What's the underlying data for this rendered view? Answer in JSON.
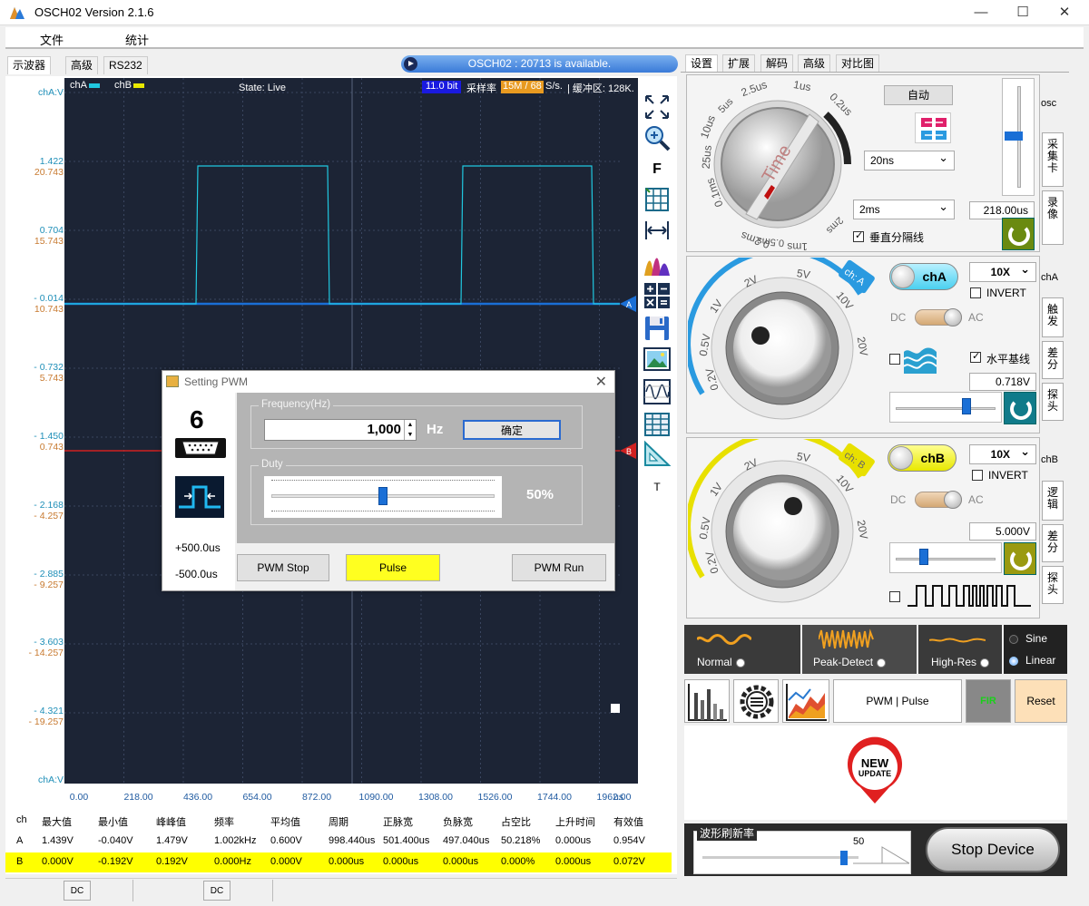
{
  "window": {
    "title": "OSCH02  Version 2.1.6",
    "minimize": "—",
    "maximize": "☐",
    "close": "✕"
  },
  "menu": {
    "file": "文件",
    "stats": "统计"
  },
  "left_tabs": [
    "示波器",
    "高级",
    "RS232"
  ],
  "banner": {
    "text": "OSCH02 : 20713 is available."
  },
  "scope": {
    "cha_label": "chA",
    "chb_label": "chB",
    "state": "State: Live",
    "bits": "11.0 bit",
    "sample_rate_label": "采样率",
    "sample_rate_value": "15M / 68",
    "sample_rate_unit": "S/s.",
    "buffer": "| 缓冲区: 128K.",
    "axis_top_label": "chA:V",
    "axis_bottom_label": "chA:V",
    "marker_a": "A",
    "marker_b": "B",
    "x_unit": "us",
    "y_labels": [
      {
        "a": "1.422",
        "b": "20.743"
      },
      {
        "a": "0.704",
        "b": "15.743"
      },
      {
        "a": "- 0.014",
        "b": "10.743"
      },
      {
        "a": "- 0.732",
        "b": "5.743"
      },
      {
        "a": "- 1.450",
        "b": "0.743"
      },
      {
        "a": "- 2.168",
        "b": "- 4.257"
      },
      {
        "a": "- 2.885",
        "b": "- 9.257"
      },
      {
        "a": "- 3.603",
        "b": "- 14.257"
      },
      {
        "a": "- 4.321",
        "b": "- 19.257"
      }
    ],
    "x_labels": [
      "0.00",
      "218.00",
      "436.00",
      "654.00",
      "872.00",
      "1090.00",
      "1308.00",
      "1526.00",
      "1744.00",
      "1962.00"
    ]
  },
  "tools": {
    "f_label": "F",
    "t_label": "T"
  },
  "measurements": {
    "headers": [
      "ch",
      "最大值",
      "最小值",
      "峰峰值",
      "频率",
      "平均值",
      "周期",
      "正脉宽",
      "负脉宽",
      "占空比",
      "上升时间",
      "有效值"
    ],
    "rows": [
      [
        "A",
        "1.439V",
        "-0.040V",
        "1.479V",
        "1.002kHz",
        "0.600V",
        "998.440us",
        "501.400us",
        "497.040us",
        "50.218%",
        "0.000us",
        "0.954V"
      ],
      [
        "B",
        "0.000V",
        "-0.192V",
        "0.192V",
        "0.000Hz",
        "0.000V",
        "0.000us",
        "0.000us",
        "0.000us",
        "0.000%",
        "0.000us",
        "0.072V"
      ]
    ]
  },
  "status": {
    "dc1": "DC",
    "dc2": "DC"
  },
  "pwm_dialog": {
    "title": "Setting PWM",
    "pin": "6",
    "plus": "+500.0us",
    "minus": "-500.0us",
    "freq_group": "Frequency(Hz)",
    "freq_value": "1,000",
    "freq_unit": "Hz",
    "confirm": "确定",
    "duty_group": "Duty",
    "duty_value": "50%",
    "duty_fraction": 0.5,
    "btn_stop": "PWM Stop",
    "btn_pulse": "Pulse",
    "btn_run": "PWM Run"
  },
  "right_tabs": [
    "设置",
    "扩展",
    "解码",
    "高级",
    "对比图"
  ],
  "time_panel": {
    "dial_labels": [
      "2.5us",
      "1us",
      "0.2us",
      "5us",
      "10us",
      "25us",
      "0.1ms",
      "0.2ms",
      "0.5ms",
      "1ms",
      "2ms"
    ],
    "dial_name": "Time",
    "auto": "自动",
    "select1": "20ns",
    "select2": "2ms",
    "vgrid_label": "垂直分隔线",
    "time_value": "218.00us",
    "side_osc": "osc",
    "tab_capture": "采集卡",
    "tab_record": "录像"
  },
  "cha_panel": {
    "dial_labels": [
      "2V",
      "5V",
      "1V",
      "10V",
      "0.5V",
      "20V",
      "0.2V"
    ],
    "tag": "ch: A",
    "pill": "chA",
    "probe": "10X",
    "invert": "INVERT",
    "dc": "DC",
    "ac": "AC",
    "baseline": "水平基线",
    "value": "0.718V",
    "slider_fraction": 0.72,
    "side": "chA",
    "tab_trigger": "触发",
    "tab_diff": "差分",
    "tab_probe": "探头"
  },
  "chb_panel": {
    "dial_labels": [
      "2V",
      "5V",
      "1V",
      "10V",
      "0.5V",
      "20V",
      "0.2V"
    ],
    "tag": "ch: B",
    "pill": "chB",
    "probe": "10X",
    "invert": "INVERT",
    "dc": "DC",
    "ac": "AC",
    "value": "5.000V",
    "slider_fraction": 0.25,
    "side": "chB",
    "tab_logic": "逻辑",
    "tab_diff": "差分",
    "tab_probe": "探头"
  },
  "modes": {
    "normal": "Normal",
    "peak": "Peak-Detect",
    "highres": "High-Res",
    "sine": "Sine",
    "linear": "Linear"
  },
  "actions": {
    "pwm_pulse": "PWM | Pulse",
    "fir": "FIR",
    "reset": "Reset"
  },
  "update_badge": {
    "line1": "NEW",
    "line2": "UPDATE"
  },
  "refresh": {
    "label": "波形刷新率",
    "value": "50",
    "fraction": 0.76
  },
  "stop_device": "Stop Device",
  "colors": {
    "cha": "#00c0e0",
    "chb": "#e8e800",
    "accent": "#1a6fd6"
  }
}
